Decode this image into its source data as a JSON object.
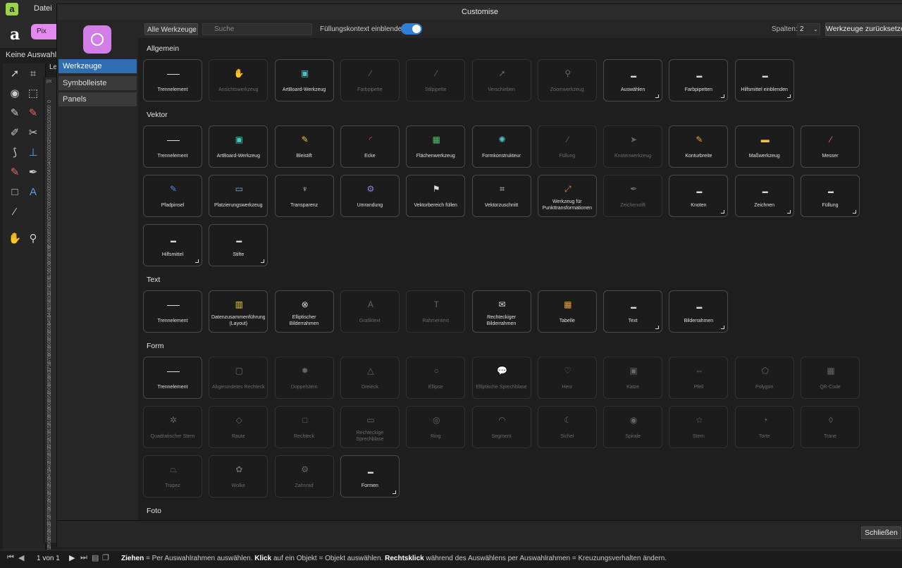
{
  "app": {
    "menu_datei": "Datei",
    "logo_glyph": "a",
    "mode_button": "Pix",
    "selection_label": "Keine Auswahl",
    "layer_tab": "Le",
    "ruler_unit": "px",
    "ruler_ticks": [
      "0",
      "50",
      "100",
      "150",
      "200",
      "250",
      "300",
      "350",
      "400",
      "450",
      "500",
      "550",
      "600",
      "650",
      "700",
      "750",
      "800",
      "850",
      "900",
      "950",
      "1000",
      "1050",
      "1100",
      "1150",
      "1200",
      "1250",
      "1300",
      "1350",
      "1400",
      "1450",
      "1500",
      "1550",
      "1600",
      "1650",
      "1700",
      "1750",
      "1800",
      "1850",
      "1900",
      "1950",
      "2000",
      "2050",
      "2100",
      "2150",
      "2200",
      "2250",
      "2300",
      "2350",
      "2400",
      "2450",
      "2500",
      "2550",
      "2600",
      "2650",
      "2700",
      "2750",
      "2800",
      "2850",
      "2900",
      "2950"
    ]
  },
  "status": {
    "page_info": "1 von 1",
    "hint_b1": "Ziehen",
    "hint_t1": " = Per Auswahlrahmen auswählen. ",
    "hint_b2": "Klick",
    "hint_t2": " auf ein Objekt = Objekt auswählen. ",
    "hint_b3": "Rechtsklick",
    "hint_t3": " während des Auswählens per Auswahlrahmen = Kreuzungsverhalten ändern."
  },
  "dialog": {
    "title": "Customise",
    "side_items": [
      "Werkzeuge",
      "Symbolleiste",
      "Panels"
    ],
    "filter_select": "Alle Werkzeuge",
    "search_placeholder": "Suche",
    "fill_context_label": "Füllungskontext einblenden",
    "fill_context_on": true,
    "columns_label": "Spalten:",
    "columns_value": "2",
    "reset_button": "Werkzeuge zurücksetzen",
    "close_button": "Schließen",
    "accent_color": "#2f6db3"
  },
  "sections": [
    {
      "title": "Allgemein",
      "tiles": [
        {
          "label": "Trennelement",
          "icon": "separator",
          "dim": false,
          "group": false
        },
        {
          "label": "Ansichtswerkzeug",
          "icon": "hand",
          "dim": true,
          "group": false
        },
        {
          "label": "ArtBoard-Werkzeug",
          "icon": "artboard",
          "dim": false,
          "group": false
        },
        {
          "label": "Farbpipette",
          "icon": "pipette",
          "dim": true,
          "group": false
        },
        {
          "label": "Stilpipette",
          "icon": "pipette",
          "dim": true,
          "group": false
        },
        {
          "label": "Verschieben",
          "icon": "pointer",
          "dim": true,
          "group": false
        },
        {
          "label": "Zoomwerkzeug",
          "icon": "zoom",
          "dim": true,
          "group": false
        },
        {
          "label": "Auswählen",
          "icon": "folder",
          "dim": false,
          "group": true
        },
        {
          "label": "Farbpipetten",
          "icon": "folder",
          "dim": false,
          "group": true
        },
        {
          "label": "Hilfsmittel einblenden",
          "icon": "folder",
          "dim": false,
          "group": true
        }
      ]
    },
    {
      "title": "Vektor",
      "tiles": [
        {
          "label": "Trennelement",
          "icon": "separator",
          "dim": false,
          "group": false
        },
        {
          "label": "ArtBoard-Werkzeug",
          "icon": "artboard",
          "dim": false,
          "group": false
        },
        {
          "label": "Bleistift",
          "icon": "pencil",
          "dim": false,
          "group": false
        },
        {
          "label": "Ecke",
          "icon": "corner",
          "dim": false,
          "group": false
        },
        {
          "label": "Flächenwerkzeug",
          "icon": "area",
          "dim": false,
          "group": false
        },
        {
          "label": "Formkonstrukteur",
          "icon": "shape-builder",
          "dim": false,
          "group": false
        },
        {
          "label": "Füllung",
          "icon": "fill",
          "dim": true,
          "group": false
        },
        {
          "label": "Knotenwerkzeug",
          "icon": "node",
          "dim": true,
          "group": false
        },
        {
          "label": "Konturbreite",
          "icon": "contour",
          "dim": false,
          "group": false
        },
        {
          "label": "Maßwerkzeug",
          "icon": "ruler",
          "dim": false,
          "group": false
        },
        {
          "label": "Messer",
          "icon": "knife",
          "dim": false,
          "group": false
        },
        {
          "label": "Pfadpinsel",
          "icon": "brush",
          "dim": false,
          "group": false
        },
        {
          "label": "Platzierungswerkzeug",
          "icon": "place",
          "dim": false,
          "group": false
        },
        {
          "label": "Transparenz",
          "icon": "transparency",
          "dim": false,
          "group": false
        },
        {
          "label": "Umrandung",
          "icon": "border",
          "dim": false,
          "group": false
        },
        {
          "label": "Vektorbereich füllen",
          "icon": "bucket",
          "dim": false,
          "group": false
        },
        {
          "label": "Vektorzuschnitt",
          "icon": "crop",
          "dim": false,
          "group": false
        },
        {
          "label": "Werkzeug für Punkttransformationen",
          "icon": "point-transform",
          "dim": false,
          "group": false
        },
        {
          "label": "Zeichenstift",
          "icon": "pen",
          "dim": true,
          "group": false
        },
        {
          "label": "Knoten",
          "icon": "folder",
          "dim": false,
          "group": true
        },
        {
          "label": "Zeichnen",
          "icon": "folder",
          "dim": false,
          "group": true
        },
        {
          "label": "Füllung",
          "icon": "folder",
          "dim": false,
          "group": true
        },
        {
          "label": "Hilfsmittel",
          "icon": "folder",
          "dim": false,
          "group": true
        },
        {
          "label": "Stifte",
          "icon": "folder",
          "dim": false,
          "group": true
        }
      ]
    },
    {
      "title": "Text",
      "tiles": [
        {
          "label": "Trennelement",
          "icon": "separator",
          "dim": false,
          "group": false
        },
        {
          "label": "Datenzusammenführung (Layout)",
          "icon": "data-merge",
          "dim": false,
          "group": false
        },
        {
          "label": "Elliptischer Bilderrahmen",
          "icon": "ellipse-frame",
          "dim": false,
          "group": false
        },
        {
          "label": "Grafiktext",
          "icon": "art-text",
          "dim": true,
          "group": false
        },
        {
          "label": "Rahmentext",
          "icon": "frame-text",
          "dim": true,
          "group": false
        },
        {
          "label": "Rechteckiger Bilderrahmen",
          "icon": "rect-frame",
          "dim": false,
          "group": false
        },
        {
          "label": "Tabelle",
          "icon": "table",
          "dim": false,
          "group": false
        },
        {
          "label": "Text",
          "icon": "folder",
          "dim": false,
          "group": true
        },
        {
          "label": "Bilderrahmen",
          "icon": "folder",
          "dim": false,
          "group": true
        }
      ]
    },
    {
      "title": "Form",
      "tiles": [
        {
          "label": "Trennelement",
          "icon": "separator",
          "dim": false,
          "group": false
        },
        {
          "label": "Abgerundetes Rechteck",
          "icon": "rounded-rect",
          "dim": true,
          "group": false
        },
        {
          "label": "Doppelstern",
          "icon": "double-star",
          "dim": true,
          "group": false
        },
        {
          "label": "Dreieck",
          "icon": "triangle",
          "dim": true,
          "group": false
        },
        {
          "label": "Ellipse",
          "icon": "ellipse",
          "dim": true,
          "group": false
        },
        {
          "label": "Elliptische Sprechblase",
          "icon": "ellipse-bubble",
          "dim": true,
          "group": false
        },
        {
          "label": "Herz",
          "icon": "heart",
          "dim": true,
          "group": false
        },
        {
          "label": "Katze",
          "icon": "cat",
          "dim": true,
          "group": false
        },
        {
          "label": "Pfeil",
          "icon": "arrow",
          "dim": true,
          "group": false
        },
        {
          "label": "Polygon",
          "icon": "polygon",
          "dim": true,
          "group": false
        },
        {
          "label": "QR-Code",
          "icon": "qr",
          "dim": true,
          "group": false
        },
        {
          "label": "Quadratischer Stern",
          "icon": "square-star",
          "dim": true,
          "group": false
        },
        {
          "label": "Raute",
          "icon": "diamond",
          "dim": true,
          "group": false
        },
        {
          "label": "Rechteck",
          "icon": "rect",
          "dim": true,
          "group": false
        },
        {
          "label": "Rechteckige Sprechblase",
          "icon": "rect-bubble",
          "dim": true,
          "group": false
        },
        {
          "label": "Ring",
          "icon": "ring",
          "dim": true,
          "group": false
        },
        {
          "label": "Segment",
          "icon": "segment",
          "dim": true,
          "group": false
        },
        {
          "label": "Sichel",
          "icon": "crescent",
          "dim": true,
          "group": false
        },
        {
          "label": "Spirale",
          "icon": "spiral",
          "dim": true,
          "group": false
        },
        {
          "label": "Stern",
          "icon": "star",
          "dim": true,
          "group": false
        },
        {
          "label": "Torte",
          "icon": "pie",
          "dim": true,
          "group": false
        },
        {
          "label": "Träne",
          "icon": "tear",
          "dim": true,
          "group": false
        },
        {
          "label": "Trapez",
          "icon": "trapezoid",
          "dim": true,
          "group": false
        },
        {
          "label": "Wolke",
          "icon": "cloud",
          "dim": true,
          "group": false
        },
        {
          "label": "Zahnrad",
          "icon": "cog",
          "dim": true,
          "group": false
        },
        {
          "label": "Formen",
          "icon": "folder",
          "dim": false,
          "group": true
        }
      ]
    },
    {
      "title": "Foto",
      "tiles": []
    }
  ]
}
